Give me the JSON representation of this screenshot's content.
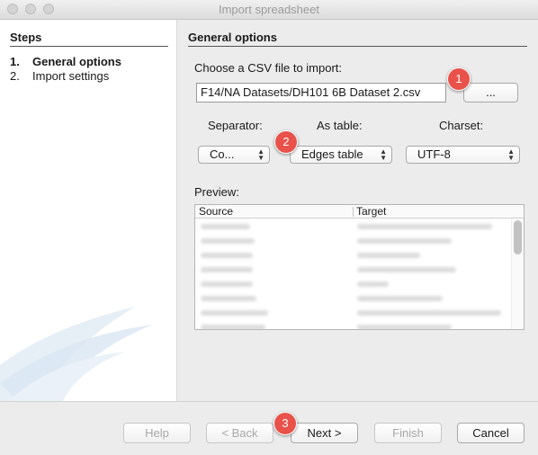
{
  "window": {
    "title": "Import spreadsheet"
  },
  "steps": {
    "heading": "Steps",
    "items": [
      {
        "num": "1.",
        "label": "General options"
      },
      {
        "num": "2.",
        "label": "Import settings"
      }
    ]
  },
  "main": {
    "heading": "General options",
    "file_label": "Choose a CSV file to import:",
    "file_value": "F14/NA Datasets/DH101 6B Dataset 2.csv",
    "browse_label": "...",
    "separator_label": "Separator:",
    "separator_value": "Co...",
    "as_table_label": "As table:",
    "as_table_value": "Edges table",
    "charset_label": "Charset:",
    "charset_value": "UTF-8",
    "preview_label": "Preview:",
    "preview_columns": [
      "Source",
      "Target"
    ]
  },
  "buttons": {
    "help": "Help",
    "back": "< Back",
    "next": "Next >",
    "finish": "Finish",
    "cancel": "Cancel"
  },
  "callouts": [
    "1",
    "2",
    "3"
  ],
  "colors": {
    "callout": "#e8524a",
    "panel": "#ececec"
  }
}
